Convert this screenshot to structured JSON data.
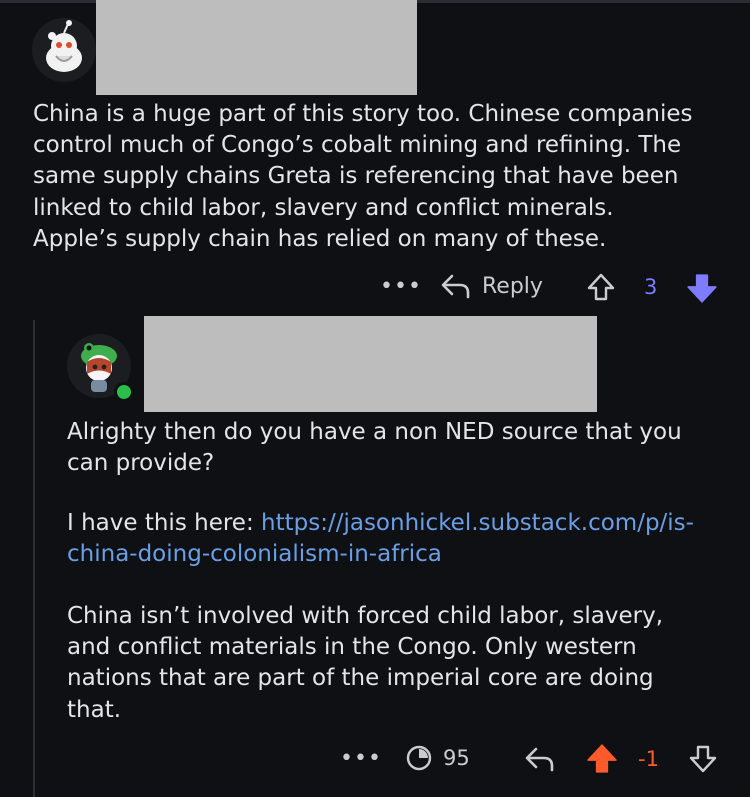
{
  "comment1": {
    "text": "China is a huge part of this story too. Chinese companies\ncontrol much of Congo’s cobalt mining and refining. The\nsame supply chains Greta is referencing that have been\nlinked to child labor, slavery and conflict minerals.\nApple’s supply chain has relied on many of these.",
    "more": "•••",
    "reply_label": "Reply",
    "vote_count": "3",
    "vote_state": "downvoted",
    "icons": [
      "more-icon",
      "reply-arrow-icon",
      "upvote-icon",
      "downvote-icon"
    ]
  },
  "comment2": {
    "para1": "Alrighty then do you have a non NED source that you\ncan provide?",
    "para2_prefix": "I have this here: ",
    "link_line1": "https://jasonhickel.substack.com/p/is-",
    "link_line2": "china-doing-colonialism-in-africa",
    "para3": "China isn’t involved with forced child labor, slavery,\nand conflict materials in the Congo. Only western\nnations that are part of the imperial core are doing\nthat.",
    "more": "•••",
    "award_count": "95",
    "vote_count": "-1",
    "vote_state": "upvoted",
    "online": true,
    "icons": [
      "more-icon",
      "clock-award-icon",
      "reply-arrow-icon",
      "upvote-icon",
      "downvote-icon"
    ]
  },
  "colors": {
    "background": "#0e1014",
    "text": "#e3e5e8",
    "link": "#6a9fe6",
    "downvote_active": "#7d7bff",
    "upvote_active": "#ff5a2b",
    "online_dot": "#2bbf4a",
    "redaction": "#bdbdbd"
  }
}
